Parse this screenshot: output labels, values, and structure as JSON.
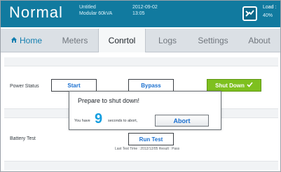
{
  "header": {
    "mode": "Normal",
    "model_line1": "Untitled",
    "model_line2": "Modular 60kVA",
    "date": "2012-09-02",
    "time": "13:05",
    "load_title": "Load :",
    "load_value": "40%",
    "load_icon": "ups-load-icon"
  },
  "tabs": [
    {
      "label": "Home",
      "icon": "home-icon"
    },
    {
      "label": "Meters"
    },
    {
      "label": "Conrtol"
    },
    {
      "label": "Logs"
    },
    {
      "label": "Settings"
    },
    {
      "label": "About"
    }
  ],
  "power_status": {
    "label": "Power Status",
    "start_label": "Start",
    "bypass_label": "Bypass",
    "shutdown_label": "Shut Down"
  },
  "battery_test": {
    "label": "Battery Test",
    "run_label": "Run Test",
    "last_test": "Last Test Time : 2012/12/05   Result : Pass"
  },
  "dialog": {
    "title": "Prepare to shut down!",
    "prefix": "You have",
    "seconds": "9",
    "suffix": "seconds to abort,",
    "abort_label": "Abort"
  },
  "colors": {
    "header_bg": "#117a9f",
    "accent_blue": "#1a6fcf",
    "shutdown_green": "#7ec01f",
    "countdown_blue": "#149ee0"
  }
}
